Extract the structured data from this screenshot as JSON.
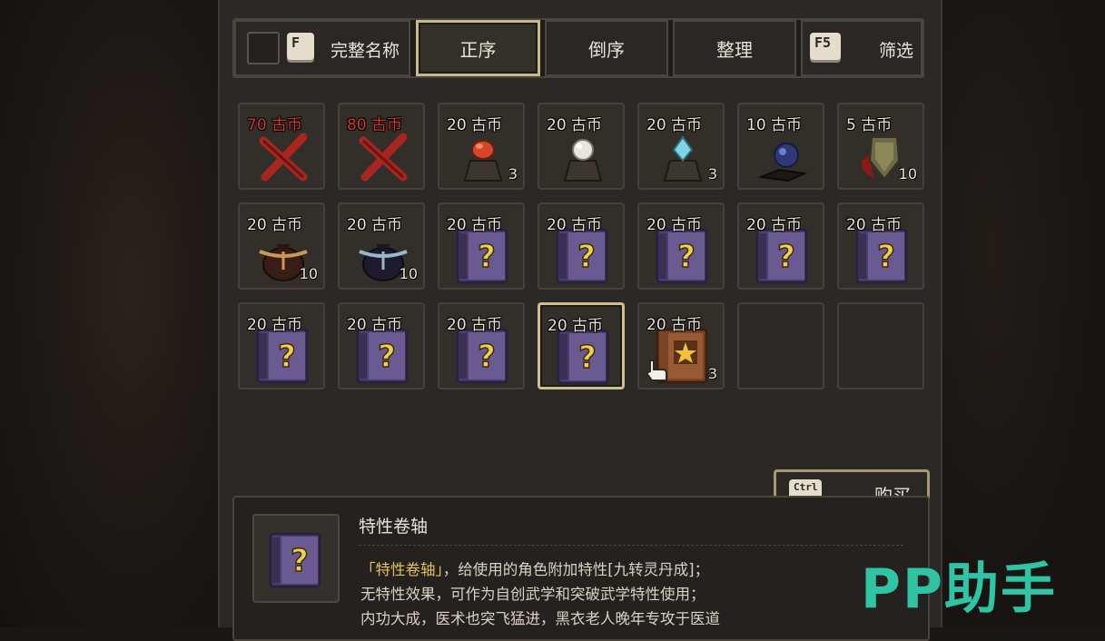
{
  "toolbar": {
    "full_name_key": "F",
    "full_name_label": "完整名称",
    "tabs": [
      {
        "label": "正序",
        "active": true
      },
      {
        "label": "倒序",
        "active": false
      },
      {
        "label": "整理",
        "active": false
      }
    ],
    "filter_key": "F5",
    "filter_label": "筛选"
  },
  "grid": {
    "rows": [
      [
        {
          "price": "70 古币",
          "price_color": "#d2372c",
          "icon": "cross-icon",
          "count": ""
        },
        {
          "price": "80 古币",
          "price_color": "#d2372c",
          "icon": "cross-icon",
          "count": ""
        },
        {
          "price": "20 古币",
          "icon": "red-gem-ore-icon",
          "count": "3"
        },
        {
          "price": "20 古币",
          "icon": "white-pearl-ore-icon",
          "count": ""
        },
        {
          "price": "20 古币",
          "icon": "blue-crystal-ore-icon",
          "count": "3"
        },
        {
          "price": "10 古币",
          "icon": "dark-blue-orb-icon",
          "count": ""
        },
        {
          "price": "5 古币",
          "icon": "shield-charm-icon",
          "count": "10"
        }
      ],
      [
        {
          "price": "20 古币",
          "icon": "golden-pouch-icon",
          "count": "10"
        },
        {
          "price": "20 古币",
          "icon": "silver-pouch-icon",
          "count": "10"
        },
        {
          "price": "20 古币",
          "icon": "mystery-scroll-icon",
          "count": ""
        },
        {
          "price": "20 古币",
          "icon": "mystery-scroll-icon",
          "count": ""
        },
        {
          "price": "20 古币",
          "icon": "mystery-scroll-icon",
          "count": ""
        },
        {
          "price": "20 古币",
          "icon": "mystery-scroll-icon",
          "count": ""
        },
        {
          "price": "20 古币",
          "icon": "mystery-scroll-icon",
          "count": ""
        }
      ],
      [
        {
          "price": "20 古币",
          "icon": "mystery-scroll-icon",
          "count": ""
        },
        {
          "price": "20 古币",
          "icon": "mystery-scroll-icon",
          "count": ""
        },
        {
          "price": "20 古币",
          "icon": "mystery-scroll-icon",
          "count": ""
        },
        {
          "price": "20 古币",
          "icon": "mystery-scroll-icon",
          "count": "",
          "selected": true
        },
        {
          "price": "20 古币",
          "icon": "star-book-icon",
          "count": "3",
          "cursor": true
        },
        {
          "empty": true
        },
        {
          "empty": true
        }
      ]
    ]
  },
  "buy": {
    "key": "Ctrl",
    "label": "购买"
  },
  "detail": {
    "title": "特性卷轴",
    "desc_highlight": "「特性卷轴」",
    "desc_line1_rest": "，给使用的角色附加特性[九转灵丹成]；",
    "desc_line2": "无特性效果，可作为自创武学和突破武学特性使用；",
    "desc_line3": "内功大成，医术也突飞猛进，黑衣老人晚年专攻于医道"
  },
  "watermark": "PP助手",
  "colors": {
    "accent_border": "#c8b98a",
    "price_red": "#d2372c",
    "highlight_yellow": "#e2c15e",
    "watermark": "#2ec4a4"
  }
}
